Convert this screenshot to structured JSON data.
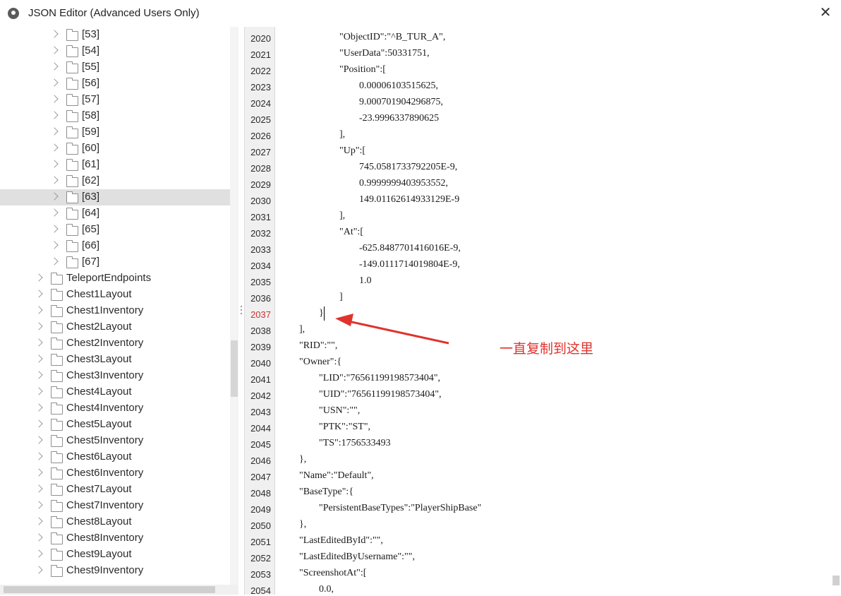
{
  "window": {
    "title": "JSON Editor (Advanced Users Only)",
    "close_glyph": "✕",
    "app_icon": "app-logo-icon",
    "close_icon": "close-icon"
  },
  "tree": {
    "items": [
      {
        "label": "[53]",
        "depth": 2,
        "selected": false
      },
      {
        "label": "[54]",
        "depth": 2,
        "selected": false
      },
      {
        "label": "[55]",
        "depth": 2,
        "selected": false
      },
      {
        "label": "[56]",
        "depth": 2,
        "selected": false
      },
      {
        "label": "[57]",
        "depth": 2,
        "selected": false
      },
      {
        "label": "[58]",
        "depth": 2,
        "selected": false
      },
      {
        "label": "[59]",
        "depth": 2,
        "selected": false
      },
      {
        "label": "[60]",
        "depth": 2,
        "selected": false
      },
      {
        "label": "[61]",
        "depth": 2,
        "selected": false
      },
      {
        "label": "[62]",
        "depth": 2,
        "selected": false
      },
      {
        "label": "[63]",
        "depth": 2,
        "selected": true
      },
      {
        "label": "[64]",
        "depth": 2,
        "selected": false
      },
      {
        "label": "[65]",
        "depth": 2,
        "selected": false
      },
      {
        "label": "[66]",
        "depth": 2,
        "selected": false
      },
      {
        "label": "[67]",
        "depth": 2,
        "selected": false
      },
      {
        "label": "TeleportEndpoints",
        "depth": 1,
        "selected": false
      },
      {
        "label": "Chest1Layout",
        "depth": 1,
        "selected": false
      },
      {
        "label": "Chest1Inventory",
        "depth": 1,
        "selected": false
      },
      {
        "label": "Chest2Layout",
        "depth": 1,
        "selected": false
      },
      {
        "label": "Chest2Inventory",
        "depth": 1,
        "selected": false
      },
      {
        "label": "Chest3Layout",
        "depth": 1,
        "selected": false
      },
      {
        "label": "Chest3Inventory",
        "depth": 1,
        "selected": false
      },
      {
        "label": "Chest4Layout",
        "depth": 1,
        "selected": false
      },
      {
        "label": "Chest4Inventory",
        "depth": 1,
        "selected": false
      },
      {
        "label": "Chest5Layout",
        "depth": 1,
        "selected": false
      },
      {
        "label": "Chest5Inventory",
        "depth": 1,
        "selected": false
      },
      {
        "label": "Chest6Layout",
        "depth": 1,
        "selected": false
      },
      {
        "label": "Chest6Inventory",
        "depth": 1,
        "selected": false
      },
      {
        "label": "Chest7Layout",
        "depth": 1,
        "selected": false
      },
      {
        "label": "Chest7Inventory",
        "depth": 1,
        "selected": false
      },
      {
        "label": "Chest8Layout",
        "depth": 1,
        "selected": false
      },
      {
        "label": "Chest8Inventory",
        "depth": 1,
        "selected": false
      },
      {
        "label": "Chest9Layout",
        "depth": 1,
        "selected": false
      },
      {
        "label": "Chest9Inventory",
        "depth": 1,
        "selected": false
      }
    ]
  },
  "editor": {
    "current_line": 2037,
    "lines": [
      {
        "no": "2020",
        "indent": 3,
        "text": "\"ObjectID\":\"^B_TUR_A\","
      },
      {
        "no": "2021",
        "indent": 3,
        "text": "\"UserData\":50331751,"
      },
      {
        "no": "2022",
        "indent": 3,
        "text": "\"Position\":["
      },
      {
        "no": "2023",
        "indent": 4,
        "text": "0.00006103515625,"
      },
      {
        "no": "2024",
        "indent": 4,
        "text": "9.000701904296875,"
      },
      {
        "no": "2025",
        "indent": 4,
        "text": "-23.9996337890625"
      },
      {
        "no": "2026",
        "indent": 3,
        "text": "],"
      },
      {
        "no": "2027",
        "indent": 3,
        "text": "\"Up\":["
      },
      {
        "no": "2028",
        "indent": 4,
        "text": "745.0581733792205E-9,"
      },
      {
        "no": "2029",
        "indent": 4,
        "text": "0.9999999403953552,"
      },
      {
        "no": "2030",
        "indent": 4,
        "text": "149.01162614933129E-9"
      },
      {
        "no": "2031",
        "indent": 3,
        "text": "],"
      },
      {
        "no": "2032",
        "indent": 3,
        "text": "\"At\":["
      },
      {
        "no": "2033",
        "indent": 4,
        "text": "-625.8487701416016E-9,"
      },
      {
        "no": "2034",
        "indent": 4,
        "text": "-149.0111714019804E-9,"
      },
      {
        "no": "2035",
        "indent": 4,
        "text": "1.0"
      },
      {
        "no": "2036",
        "indent": 3,
        "text": "]"
      },
      {
        "no": "2037",
        "indent": 2,
        "text": "}"
      },
      {
        "no": "2038",
        "indent": 1,
        "text": "],"
      },
      {
        "no": "2039",
        "indent": 1,
        "text": "\"RID\":\"\","
      },
      {
        "no": "2040",
        "indent": 1,
        "text": "\"Owner\":{"
      },
      {
        "no": "2041",
        "indent": 2,
        "text": "\"LID\":\"76561199198573404\","
      },
      {
        "no": "2042",
        "indent": 2,
        "text": "\"UID\":\"76561199198573404\","
      },
      {
        "no": "2043",
        "indent": 2,
        "text": "\"USN\":\"\","
      },
      {
        "no": "2044",
        "indent": 2,
        "text": "\"PTK\":\"ST\","
      },
      {
        "no": "2045",
        "indent": 2,
        "text": "\"TS\":1756533493"
      },
      {
        "no": "2046",
        "indent": 1,
        "text": "},"
      },
      {
        "no": "2047",
        "indent": 1,
        "text": "\"Name\":\"Default\","
      },
      {
        "no": "2048",
        "indent": 1,
        "text": "\"BaseType\":{"
      },
      {
        "no": "2049",
        "indent": 2,
        "text": "\"PersistentBaseTypes\":\"PlayerShipBase\""
      },
      {
        "no": "2050",
        "indent": 1,
        "text": "},"
      },
      {
        "no": "2051",
        "indent": 1,
        "text": "\"LastEditedById\":\"\","
      },
      {
        "no": "2052",
        "indent": 1,
        "text": "\"LastEditedByUsername\":\"\","
      },
      {
        "no": "2053",
        "indent": 1,
        "text": "\"ScreenshotAt\":["
      },
      {
        "no": "2054",
        "indent": 2,
        "text": "0.0,"
      }
    ]
  },
  "annotation": {
    "text": "一直复制到这里",
    "color": "#e0332c"
  }
}
